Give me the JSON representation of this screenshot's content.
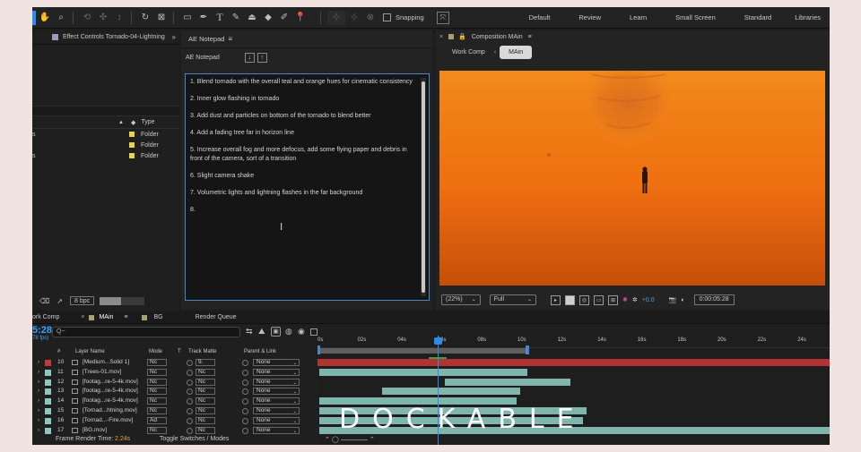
{
  "toolbar": {
    "snapping_label": "Snapping",
    "workspaces": [
      "Default",
      "Review",
      "Learn",
      "Small Screen",
      "Standard",
      "Libraries"
    ]
  },
  "effect_controls": {
    "title": "Effect Controls Tornado-04-Lightning",
    "more": "»"
  },
  "project": {
    "type_header": "Type",
    "rows": [
      {
        "type": "Folder",
        "left_mark": "s"
      },
      {
        "type": "Folder",
        "left_mark": ""
      },
      {
        "type": "Folder",
        "left_mark": "s"
      }
    ],
    "bpc": "8 bpc"
  },
  "notepad": {
    "tab_title": "AE Notepad",
    "header_label": "AE Notepad",
    "down_btn": "↓",
    "up_btn": "↑",
    "lines": [
      "1. Blend tornado with the overall teal and orange hues for cinematic consistency",
      "2. Inner glow flashing in tornado",
      "3. Add dust and particles on bottom of the tornado to blend better",
      "4. Add a fading tree far in horizon line",
      "5. Increase overall fog and more defocus, add some flying paper and debris in front of the      camera, sort of a transition",
      "6. Slight camera shake",
      "7. Volumetric lights and lightning flashes in the far background",
      "8."
    ]
  },
  "composition": {
    "tab_title": "Composition MAin",
    "crumb_parent": "Work Comp",
    "crumb_active": "MAin",
    "zoom": "(22%)",
    "resolution": "Full",
    "exposure": "+0.0",
    "timecode": "0:00:05:28"
  },
  "timeline": {
    "tabs": [
      "ork Comp",
      "MAin",
      "BG",
      "Render Queue"
    ],
    "current_time": "5:28",
    "frame_sub": "78 fps)",
    "search_placeholder": "Q~",
    "headers": {
      "num": "#",
      "layer_name": "Layer Name",
      "mode": "Mode",
      "t": "T",
      "track_matte": "Track Matte",
      "parent": "Parent & Link"
    },
    "layers": [
      {
        "num": "10",
        "name": "[Medium...Solid 1]",
        "mode": "Nc",
        "matte": "9.",
        "parent": "None",
        "color": "red"
      },
      {
        "num": "11",
        "name": "[Trees-01.mov]",
        "mode": "Nc",
        "matte": "Nc",
        "parent": "None",
        "color": "teal"
      },
      {
        "num": "12",
        "name": "[footag...re-5-4k.mov]",
        "mode": "Nc",
        "matte": "Nc",
        "parent": "None",
        "color": "teal"
      },
      {
        "num": "13",
        "name": "[footag...re-5-4k.mov]",
        "mode": "Nc",
        "matte": "Nc",
        "parent": "None",
        "color": "teal"
      },
      {
        "num": "14",
        "name": "[footag...re-5-4k.mov]",
        "mode": "Nc",
        "matte": "Nc",
        "parent": "None",
        "color": "teal"
      },
      {
        "num": "15",
        "name": "[Tornad...htning.mov]",
        "mode": "Nc",
        "matte": "Nc",
        "parent": "None",
        "color": "teal"
      },
      {
        "num": "16",
        "name": "[Tornad...-Fire.mov]",
        "mode": "Ad",
        "matte": "Nc",
        "parent": "None",
        "color": "teal"
      },
      {
        "num": "17",
        "name": "[BG.mov]",
        "mode": "Nc",
        "matte": "Nc",
        "parent": "None",
        "color": "teal"
      }
    ],
    "ruler_ticks": [
      "0s",
      "02s",
      "04s",
      "06s",
      "08s",
      "10s",
      "12s",
      "14s",
      "16s",
      "18s",
      "20s",
      "22s",
      "24s"
    ],
    "frame_render_label": "Frame Render Time:",
    "frame_render_value": "2.24s",
    "toggle_label": "Toggle Switches / Modes"
  },
  "overlay": {
    "watermark": "DOCKABLE"
  },
  "colors": {
    "accent": "#2d8ceb",
    "label_teal": "#7fb5ad",
    "label_red": "#b03434",
    "folder": "#e6d44a"
  }
}
